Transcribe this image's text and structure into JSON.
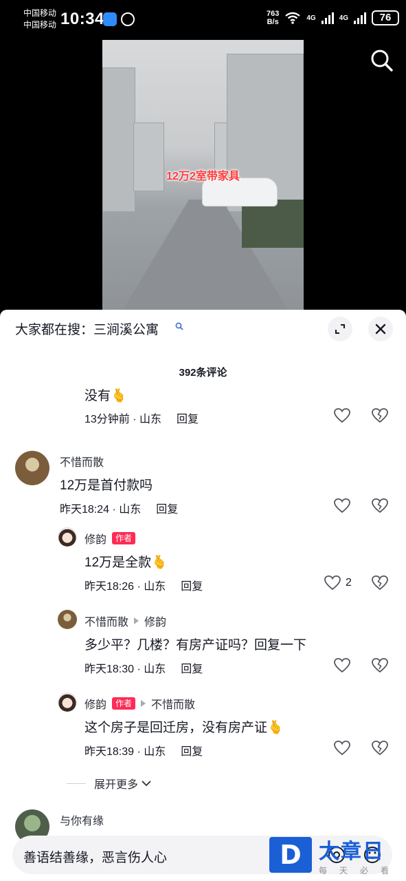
{
  "status": {
    "carrier1": "中国移动",
    "carrier2": "中国移动",
    "time": "10:34",
    "speed_value": "763",
    "speed_unit": "B/s",
    "net1": "4G",
    "net2": "4G",
    "battery": "76"
  },
  "video": {
    "caption": "12万2室带家具"
  },
  "sheet": {
    "hot_search_prefix": "大家都在搜：",
    "hot_search_keyword": "三涧溪公寓",
    "comment_count": "392条评论",
    "reply_label": "回复",
    "author_label": "作者",
    "expand_more": "展开更多"
  },
  "comments": [
    {
      "text": "没有🫰",
      "time": "13分钟前",
      "loc": "山东"
    },
    {
      "user": "不惜而散",
      "text": "12万是首付款吗",
      "time": "昨天18:24",
      "loc": "山东"
    },
    {
      "user": "修韵",
      "text": "12万是全款🫰",
      "time": "昨天18:26",
      "loc": "山东",
      "likes": "2"
    },
    {
      "user": "不惜而散",
      "reply_to": "修韵",
      "text": "多少平？几楼？有房产证吗？回复一下",
      "time": "昨天18:30",
      "loc": "山东"
    },
    {
      "user": "修韵",
      "reply_to": "不惜而散",
      "text": "这个房子是回迁房，没有房产证🫰",
      "time": "昨天18:39",
      "loc": "山东"
    },
    {
      "user": "与你有缘"
    }
  ],
  "input": {
    "placeholder": "善语结善缘，恶言伤人心"
  },
  "watermark": {
    "logo": "D",
    "name": "太章日",
    "sub": "每天必看"
  }
}
